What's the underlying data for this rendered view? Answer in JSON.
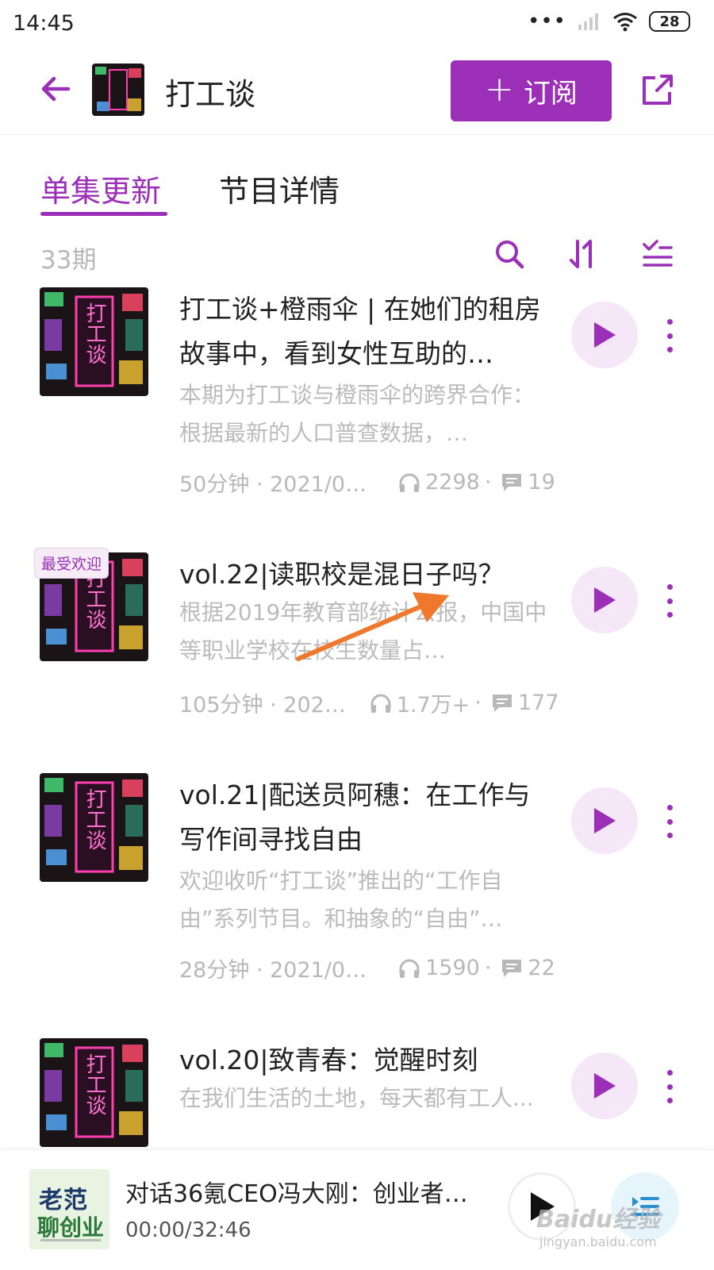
{
  "status_bar": {
    "time": "14:45",
    "battery": "28"
  },
  "header": {
    "title": "打工谈",
    "subscribe_label": "订阅"
  },
  "tabs": [
    {
      "label": "单集更新"
    },
    {
      "label": "节目详情"
    }
  ],
  "list": {
    "count": "33期"
  },
  "cover_text": "打工谈",
  "episodes": [
    {
      "title": "打工谈+橙雨伞 | 在她们的租房故事中，看到女性互助的…",
      "desc": "本期为打工谈与橙雨伞的跨界合作：根据最新的人口普查数据，…",
      "duration_date": "50分钟 · 2021/0…",
      "listens": "2298",
      "comments": "19"
    },
    {
      "badge": "最受欢迎",
      "title": "vol.22|读职校是混日子吗？",
      "desc": "根据2019年教育部统计公报，中国中等职业学校在校生数量占…",
      "duration_date": "105分钟 · 202…",
      "listens": "1.7万+",
      "comments": "177"
    },
    {
      "title": "vol.21|配送员阿穗：在工作与写作间寻找自由",
      "desc": "欢迎收听“打工谈”推出的“工作自由”系列节目。和抽象的“自由”…",
      "duration_date": "28分钟 · 2021/0…",
      "listens": "1590",
      "comments": "22"
    },
    {
      "title": "vol.20|致青春：觉醒时刻",
      "desc": "在我们生活的土地，每天都有工人..."
    }
  ],
  "miniplayer": {
    "title": "对话36氪CEO冯大刚：创业者…",
    "time": "00:00/32:46",
    "cover_line1": "老范",
    "cover_line2": "聊创业"
  },
  "watermark": {
    "text": "Baidu经验",
    "sub": "jingyan.baidu.com"
  },
  "colors": {
    "accent": "#9b2fb8",
    "play_bg": "#f5e7f8",
    "muted": "#bbbbbb"
  }
}
